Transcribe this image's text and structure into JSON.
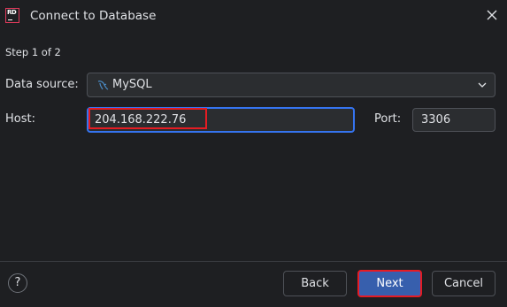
{
  "window": {
    "title": "Connect to Database",
    "app_logo_text": "RD"
  },
  "step": "Step 1 of 2",
  "form": {
    "data_source_label": "Data source:",
    "data_source_value": "MySQL",
    "data_source_icon": "mysql-dolphin-icon",
    "host_label": "Host:",
    "host_value": "204.168.222.76",
    "port_label": "Port:",
    "port_value": "3306"
  },
  "footer": {
    "help_label": "?",
    "back_label": "Back",
    "next_label": "Next",
    "cancel_label": "Cancel"
  },
  "colors": {
    "background": "#1e1f22",
    "input_background": "#2b2d30",
    "focus_border": "#3574f0",
    "primary_button": "#375fad",
    "highlight_annotation": "#e51c23",
    "logo_accent": "#e03a5b"
  }
}
